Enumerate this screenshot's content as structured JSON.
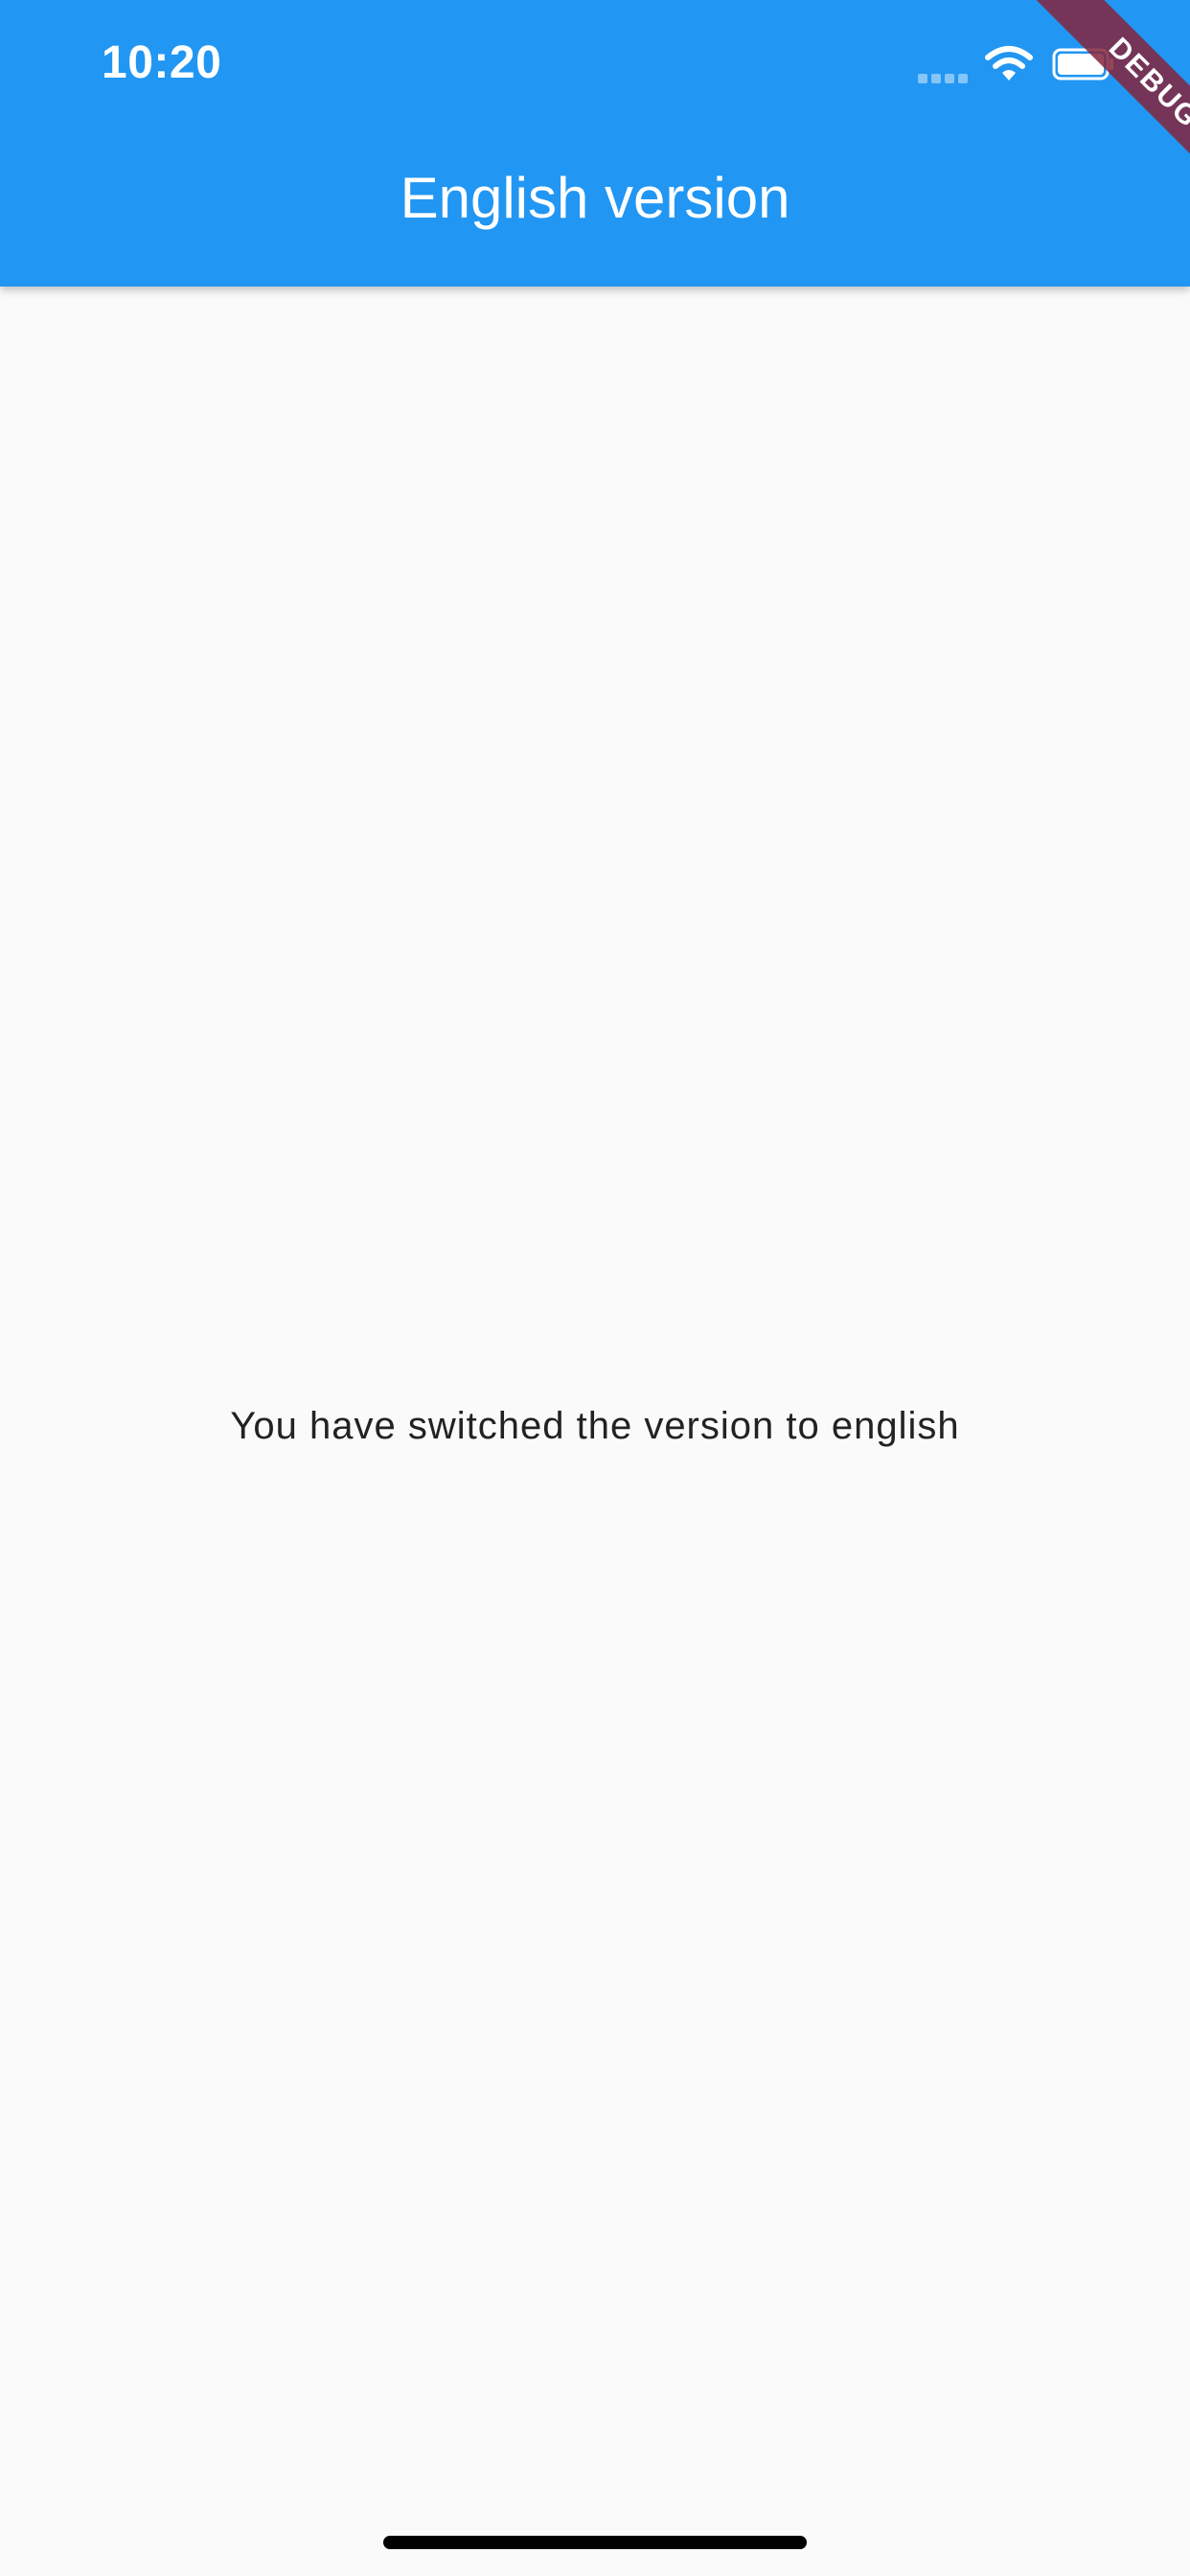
{
  "status_bar": {
    "time": "10:20"
  },
  "app_bar": {
    "title": "English version",
    "background_color": "#2196f3"
  },
  "debug_banner": {
    "label": "DEBUG"
  },
  "body": {
    "message": "You have switched the version to english",
    "background_color": "#fafafa"
  },
  "icons": [
    "signal-icon",
    "wifi-icon",
    "battery-icon"
  ]
}
